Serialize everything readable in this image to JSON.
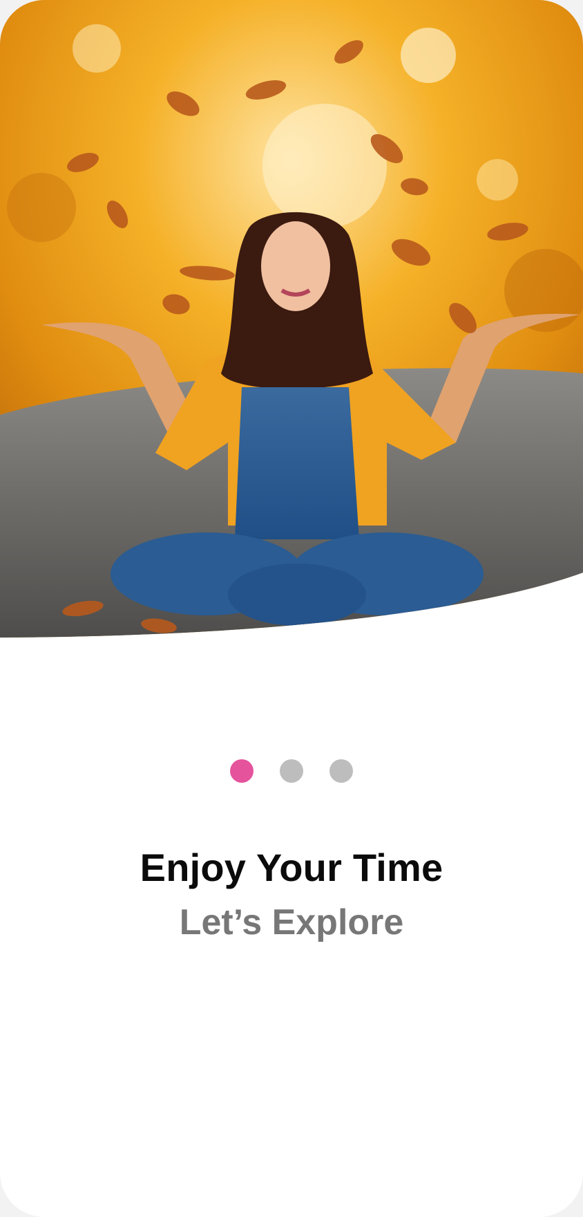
{
  "onboarding": {
    "hero_image": "woman-throwing-autumn-leaves-photo",
    "title": "Enjoy Your Time",
    "subtitle": "Let’s Explore",
    "pager": {
      "pages": 3,
      "active_index": 0,
      "active_color": "#e5539d",
      "inactive_color": "#bdbdbd"
    }
  }
}
